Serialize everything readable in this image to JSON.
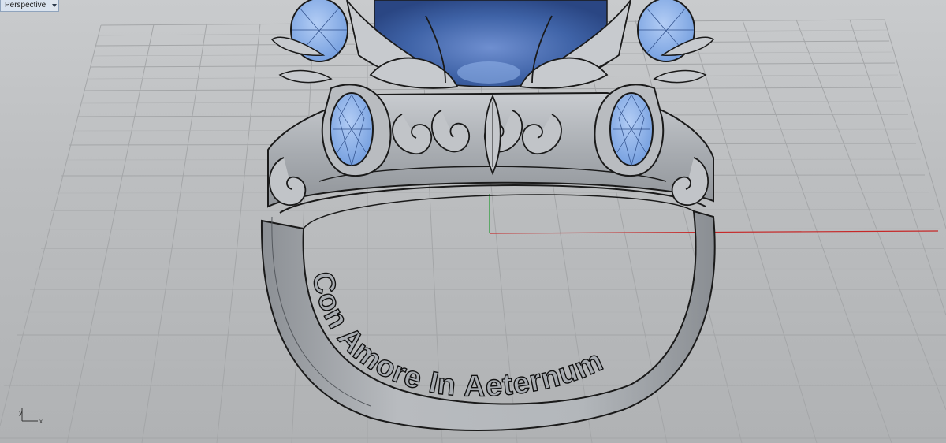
{
  "viewport": {
    "title": "Perspective"
  },
  "engraving": {
    "text": "Con Amore In Aeternum"
  },
  "axis_indicator": {
    "x_label": "x",
    "y_label": "y"
  },
  "colors": {
    "background": "#bcbec0",
    "grid": "#a5a7a9",
    "metal": "#a9adb1",
    "gem": "#7fa7e2",
    "center_stone": "#3f63a7",
    "x_axis": "#c62828",
    "y_axis": "#1f9a2e"
  }
}
